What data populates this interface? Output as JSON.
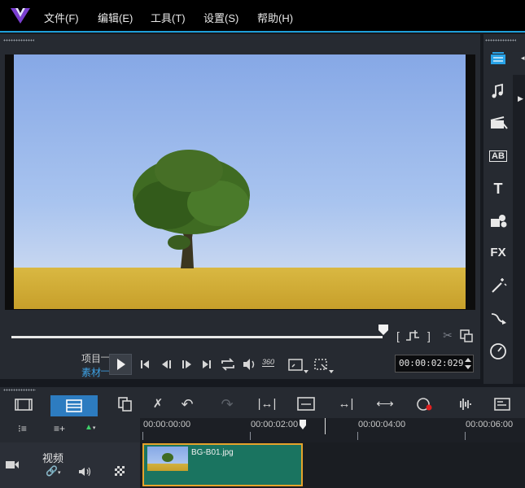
{
  "menu": [
    "文件(F)",
    "编辑(E)",
    "工具(T)",
    "设置(S)",
    "帮助(H)"
  ],
  "player": {
    "mode_project": "项目",
    "mode_clip": "素材",
    "timecode": "00:00:02:029",
    "badge_360": "360"
  },
  "library_icons": [
    "media-icon",
    "audio-icon",
    "instant-project-icon",
    "title-icon",
    "text-icon",
    "graphics-icon",
    "fx-icon",
    "magic-icon",
    "path-icon",
    "speed-icon"
  ],
  "library_labels": {
    "title": "AB",
    "text": "T",
    "fx": "FX"
  },
  "timeline": {
    "ticks": [
      "00:00:00:00",
      "00:00:02:00",
      "00:00:04:00",
      "00:00:06:00"
    ],
    "track_name": "视频",
    "clip_name": "BG-B01.jpg"
  },
  "colors": {
    "accent": "#1e9fd8",
    "clip_border": "#e5a32b",
    "clip_fill": "#1a7460"
  }
}
